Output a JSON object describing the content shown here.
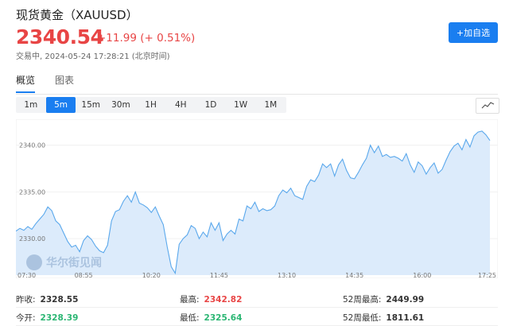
{
  "header": {
    "title": "现货黄金（XAUUSD）",
    "price": "2340.54",
    "change": "+11.99 (+ 0.51%)",
    "status": "交易中, 2024-05-24 17:28:21 (北京时间)",
    "add_button": "+加自选"
  },
  "tabs": [
    {
      "label": "概览",
      "active": true
    },
    {
      "label": "图表",
      "active": false
    }
  ],
  "ranges": [
    {
      "label": "1m",
      "active": false
    },
    {
      "label": "5m",
      "active": true
    },
    {
      "label": "15m",
      "active": false
    },
    {
      "label": "30m",
      "active": false
    },
    {
      "label": "1H",
      "active": false
    },
    {
      "label": "4H",
      "active": false
    },
    {
      "label": "1D",
      "active": false
    },
    {
      "label": "1W",
      "active": false
    },
    {
      "label": "1M",
      "active": false
    }
  ],
  "chart_type_icon": "line-chart-icon",
  "watermark": "华尔街见闻",
  "colors": {
    "up": "#e84545",
    "down": "#2bb673",
    "accent": "#1a7ef0",
    "line": "#5aa8ec",
    "fill": "#dcebfb"
  },
  "chart_data": {
    "type": "area",
    "y_ticks": [
      "2340.00",
      "2335.00",
      "2330.00"
    ],
    "y_tick_values": [
      2340,
      2335,
      2330
    ],
    "ylim": [
      2326.1,
      2342.6
    ],
    "x_ticks": [
      "07:30",
      "08:55",
      "10:20",
      "11:45",
      "13:10",
      "14:35",
      "16:00",
      "17:25"
    ],
    "x_tick_values": [
      0,
      17,
      34,
      51,
      68,
      85,
      102,
      119
    ],
    "xlim": [
      0,
      121
    ],
    "grid": true,
    "series": [
      {
        "values": [
          2330.8,
          2331.1,
          2330.9,
          2331.3,
          2331.0,
          2331.6,
          2332.1,
          2332.6,
          2333.4,
          2333.0,
          2331.9,
          2331.5,
          2330.6,
          2329.7,
          2329.1,
          2329.3,
          2328.6,
          2329.8,
          2330.3,
          2329.9,
          2329.2,
          2328.7,
          2328.5,
          2329.3,
          2331.9,
          2332.9,
          2333.1,
          2334.0,
          2334.6,
          2333.9,
          2335.0,
          2333.8,
          2333.6,
          2333.3,
          2332.8,
          2333.4,
          2332.4,
          2331.5,
          2329.1,
          2327.0,
          2326.3,
          2329.4,
          2330.0,
          2330.4,
          2331.4,
          2331.1,
          2330.0,
          2330.7,
          2330.2,
          2331.7,
          2330.9,
          2331.7,
          2329.8,
          2330.5,
          2330.9,
          2330.5,
          2332.1,
          2331.9,
          2333.5,
          2333.2,
          2333.9,
          2332.9,
          2333.2,
          2333.0,
          2333.1,
          2333.5,
          2334.6,
          2335.2,
          2334.9,
          2335.4,
          2334.6,
          2334.4,
          2334.2,
          2335.6,
          2336.3,
          2336.1,
          2336.8,
          2338.0,
          2337.6,
          2338.0,
          2336.7,
          2337.9,
          2338.5,
          2337.3,
          2336.5,
          2336.4,
          2337.1,
          2337.9,
          2338.6,
          2340.0,
          2339.2,
          2339.9,
          2338.8,
          2339.0,
          2338.7,
          2338.8,
          2338.6,
          2338.3,
          2339.1,
          2337.9,
          2337.1,
          2338.2,
          2337.8,
          2336.9,
          2337.6,
          2338.1,
          2337.0,
          2337.4,
          2338.4,
          2339.3,
          2339.9,
          2340.2,
          2339.5,
          2340.6,
          2339.8,
          2341.0,
          2341.4,
          2341.5,
          2341.1,
          2340.5
        ]
      }
    ]
  },
  "stats": [
    [
      {
        "label": "昨收:",
        "value": "2328.55",
        "color": "#333333"
      },
      {
        "label": "最高:",
        "value": "2342.82",
        "color": "#e84545"
      },
      {
        "label": "52周最高:",
        "value": "2449.99",
        "color": "#333333"
      }
    ],
    [
      {
        "label": "今开:",
        "value": "2328.39",
        "color": "#2bb673"
      },
      {
        "label": "最低:",
        "value": "2325.64",
        "color": "#2bb673"
      },
      {
        "label": "52周最低:",
        "value": "1811.61",
        "color": "#333333"
      }
    ]
  ]
}
